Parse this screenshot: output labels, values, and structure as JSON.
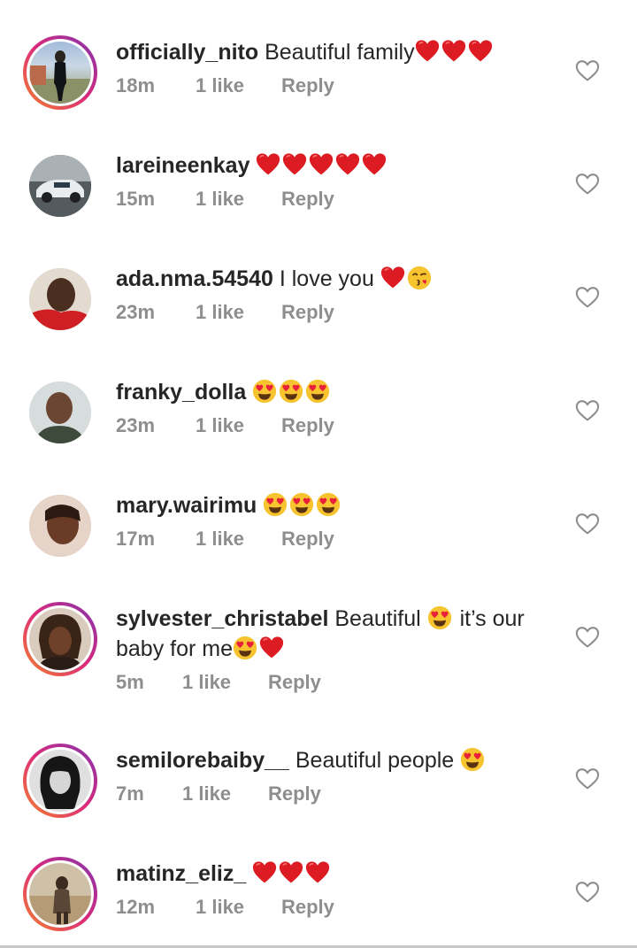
{
  "comments": [
    {
      "username": "officially_nito",
      "text": " Beautiful family",
      "emojis": [
        "red-heart",
        "red-heart",
        "red-heart"
      ],
      "time": "18m",
      "likes": "1 like",
      "reply": "Reply",
      "story_ring": true,
      "avatar": "avatar-person-standing"
    },
    {
      "username": "lareineenkay",
      "text": " ",
      "emojis": [
        "red-heart",
        "red-heart",
        "red-heart",
        "red-heart",
        "red-heart"
      ],
      "time": "15m",
      "likes": "1 like",
      "reply": "Reply",
      "story_ring": false,
      "avatar": "avatar-car"
    },
    {
      "username": "ada.nma.54540",
      "text": " I love you ",
      "emojis": [
        "red-heart",
        "kissing-face"
      ],
      "time": "23m",
      "likes": "1 like",
      "reply": "Reply",
      "story_ring": false,
      "avatar": "avatar-woman-red"
    },
    {
      "username": "franky_dolla",
      "text": " ",
      "emojis": [
        "heart-eyes",
        "heart-eyes",
        "heart-eyes"
      ],
      "time": "23m",
      "likes": "1 like",
      "reply": "Reply",
      "story_ring": false,
      "avatar": "avatar-man"
    },
    {
      "username": "mary.wairimu",
      "text": " ",
      "emojis": [
        "heart-eyes",
        "heart-eyes",
        "heart-eyes"
      ],
      "time": "17m",
      "likes": "1 like",
      "reply": "Reply",
      "story_ring": false,
      "avatar": "avatar-woman"
    },
    {
      "username": "sylvester_christabel",
      "text": " Beautiful ",
      "emojis_mid": [
        "heart-eyes"
      ],
      "text2": " it’s our baby for me",
      "emojis": [
        "heart-eyes",
        "red-heart"
      ],
      "time": "5m",
      "likes": "1 like",
      "reply": "Reply",
      "story_ring": true,
      "avatar": "avatar-girl-braids"
    },
    {
      "username": "semilorebaiby__",
      "text": " Beautiful people ",
      "emojis": [
        "heart-eyes"
      ],
      "time": "7m",
      "likes": "1 like",
      "reply": "Reply",
      "story_ring": true,
      "avatar": "avatar-woman-bw"
    },
    {
      "username": "matinz_eliz_",
      "text": " ",
      "emojis": [
        "red-heart",
        "red-heart",
        "red-heart"
      ],
      "time": "12m",
      "likes": "1 like",
      "reply": "Reply",
      "story_ring": true,
      "avatar": "avatar-person-outdoors"
    }
  ],
  "colors": {
    "username": "#262626",
    "meta": "#8e8e8e",
    "heart_emoji": "#e0141e",
    "like_icon": "#8e8e8e"
  }
}
